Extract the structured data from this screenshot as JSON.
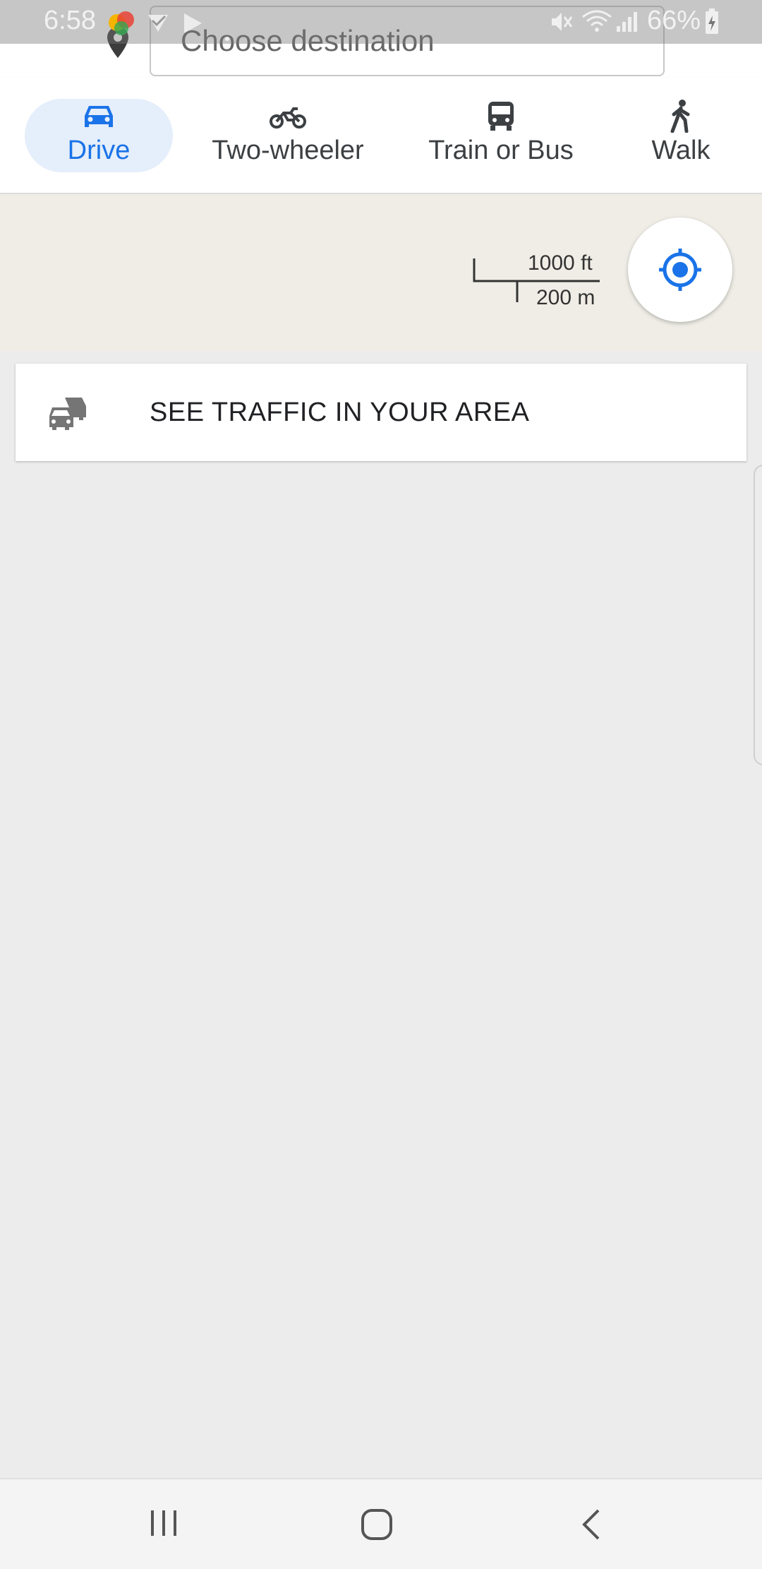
{
  "status_bar": {
    "time": "6:58",
    "battery": "66%"
  },
  "search": {
    "placeholder": "Choose destination"
  },
  "modes": [
    {
      "label": "Drive",
      "icon": "car-icon",
      "selected": true
    },
    {
      "label": "Two-wheeler",
      "icon": "motorcycle-icon",
      "selected": false
    },
    {
      "label": "Train or Bus",
      "icon": "bus-icon",
      "selected": false
    },
    {
      "label": "Walk",
      "icon": "walk-icon",
      "selected": false
    }
  ],
  "map": {
    "scale_imperial": "1000 ft",
    "scale_metric": "200 m"
  },
  "traffic_card": {
    "label": "SEE TRAFFIC IN YOUR AREA",
    "icon": "traffic-cars-icon"
  },
  "colors": {
    "accent": "#1a73e8",
    "selected_tab_bg": "#e5eefb",
    "map_bg": "#efede6"
  }
}
